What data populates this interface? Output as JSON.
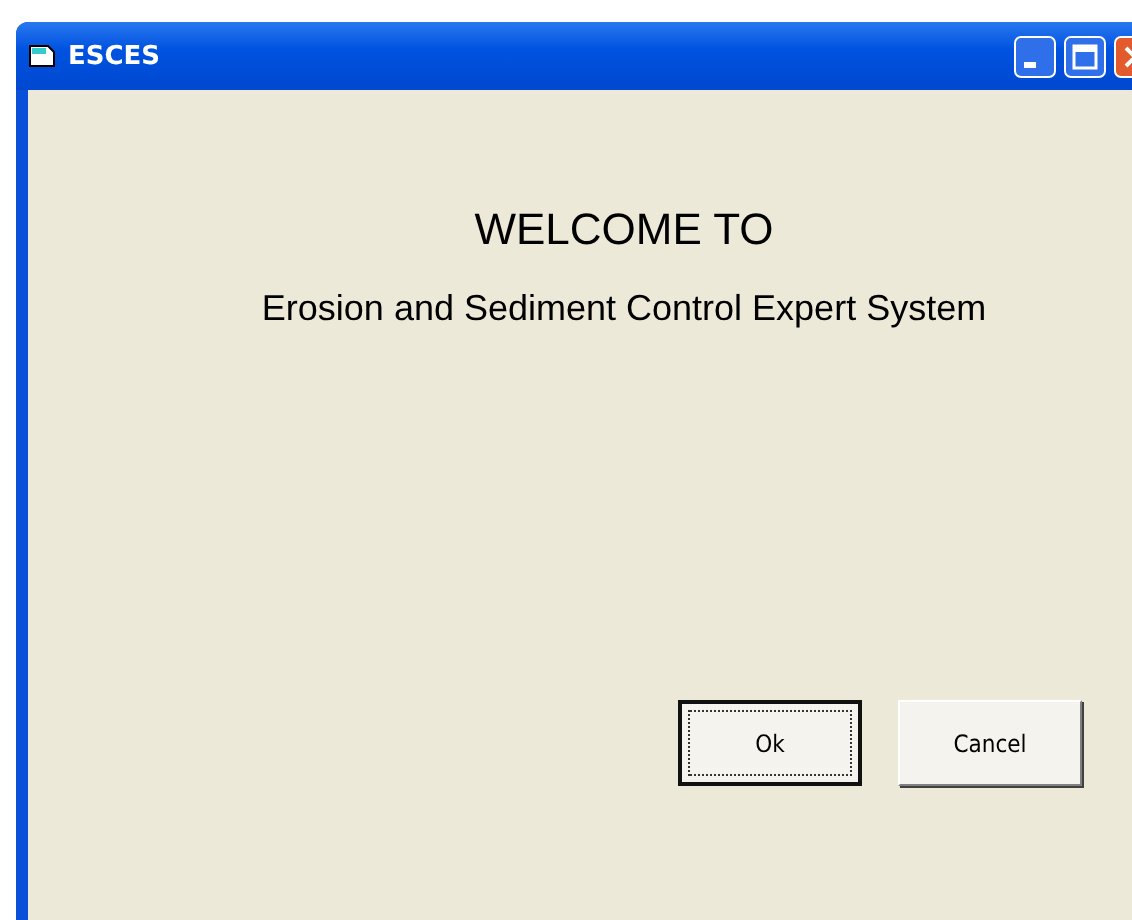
{
  "window": {
    "title": "ESCES"
  },
  "heading": "WELCOME TO",
  "subtitle": "Erosion and Sediment Control Expert System",
  "buttons": [
    {
      "label": "Ok",
      "focused": true
    },
    {
      "label": "Cancel",
      "focused": false
    }
  ]
}
